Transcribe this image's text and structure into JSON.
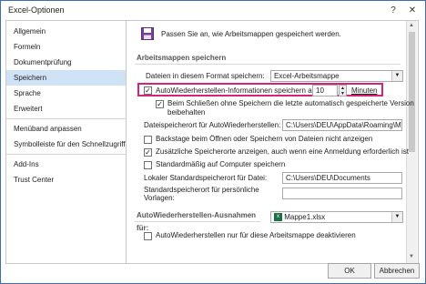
{
  "window": {
    "title": "Excel-Optionen",
    "help": "?",
    "close": "✕"
  },
  "sidebar": {
    "items": [
      {
        "label": "Allgemein"
      },
      {
        "label": "Formeln"
      },
      {
        "label": "Dokumentprüfung"
      },
      {
        "label": "Speichern",
        "active": true
      },
      {
        "label": "Sprache"
      },
      {
        "label": "Erweitert"
      },
      {
        "label": "Menüband anpassen"
      },
      {
        "label": "Symbolleiste für den Schnellzugriff"
      },
      {
        "label": "Add-Ins"
      },
      {
        "label": "Trust Center"
      }
    ]
  },
  "main": {
    "intro": "Passen Sie an, wie Arbeitsmappen gespeichert werden.",
    "section_save": "Arbeitsmappen speichern",
    "format_label": "Dateien in diesem Format speichern:",
    "format_value": "Excel-Arbeitsmappe",
    "autorecover_label": "AutoWiederherstellen-Informationen speichern alle",
    "autorecover_minutes": "10",
    "minutes_label": "Minuten",
    "keep_last_line1": "Beim Schließen ohne Speichern die letzte automatisch gespeicherte Version",
    "keep_last_line2": "beibehalten",
    "autorecover_location_label": "Dateispeicherort für AutoWiederherstellen:",
    "autorecover_location_value": "C:\\Users\\DEU\\AppData\\Roaming\\Micro",
    "backstage_label": "Backstage beim Öffnen oder Speichern von Dateien nicht anzeigen",
    "additional_locations_label": "Zusätzliche Speicherorte anzeigen, auch wenn eine Anmeldung erforderlich ist",
    "default_computer_label": "Standardmäßig auf Computer speichern",
    "local_default_label": "Lokaler Standardspeicherort für Datei:",
    "local_default_value": "C:\\Users\\DEU\\Documents",
    "personal_templates_line1": "Standardspeicherort für persönliche",
    "personal_templates_line2": "Vorlagen:",
    "personal_templates_value": "",
    "section_exceptions": "AutoWiederherstellen-Ausnahmen für:",
    "exceptions_value": "Mappe1.xlsx",
    "disable_autorecover_label": "AutoWiederherstellen nur für diese Arbeitsmappe deaktivieren"
  },
  "checks": {
    "autorecover": true,
    "keep_last": true,
    "backstage": false,
    "additional_locations": true,
    "default_computer": false,
    "disable_autorecover": false
  },
  "footer": {
    "ok": "OK",
    "cancel": "Abbrechen"
  },
  "colors": {
    "highlight": "#d4237a",
    "active_nav": "#cfe2f6"
  }
}
